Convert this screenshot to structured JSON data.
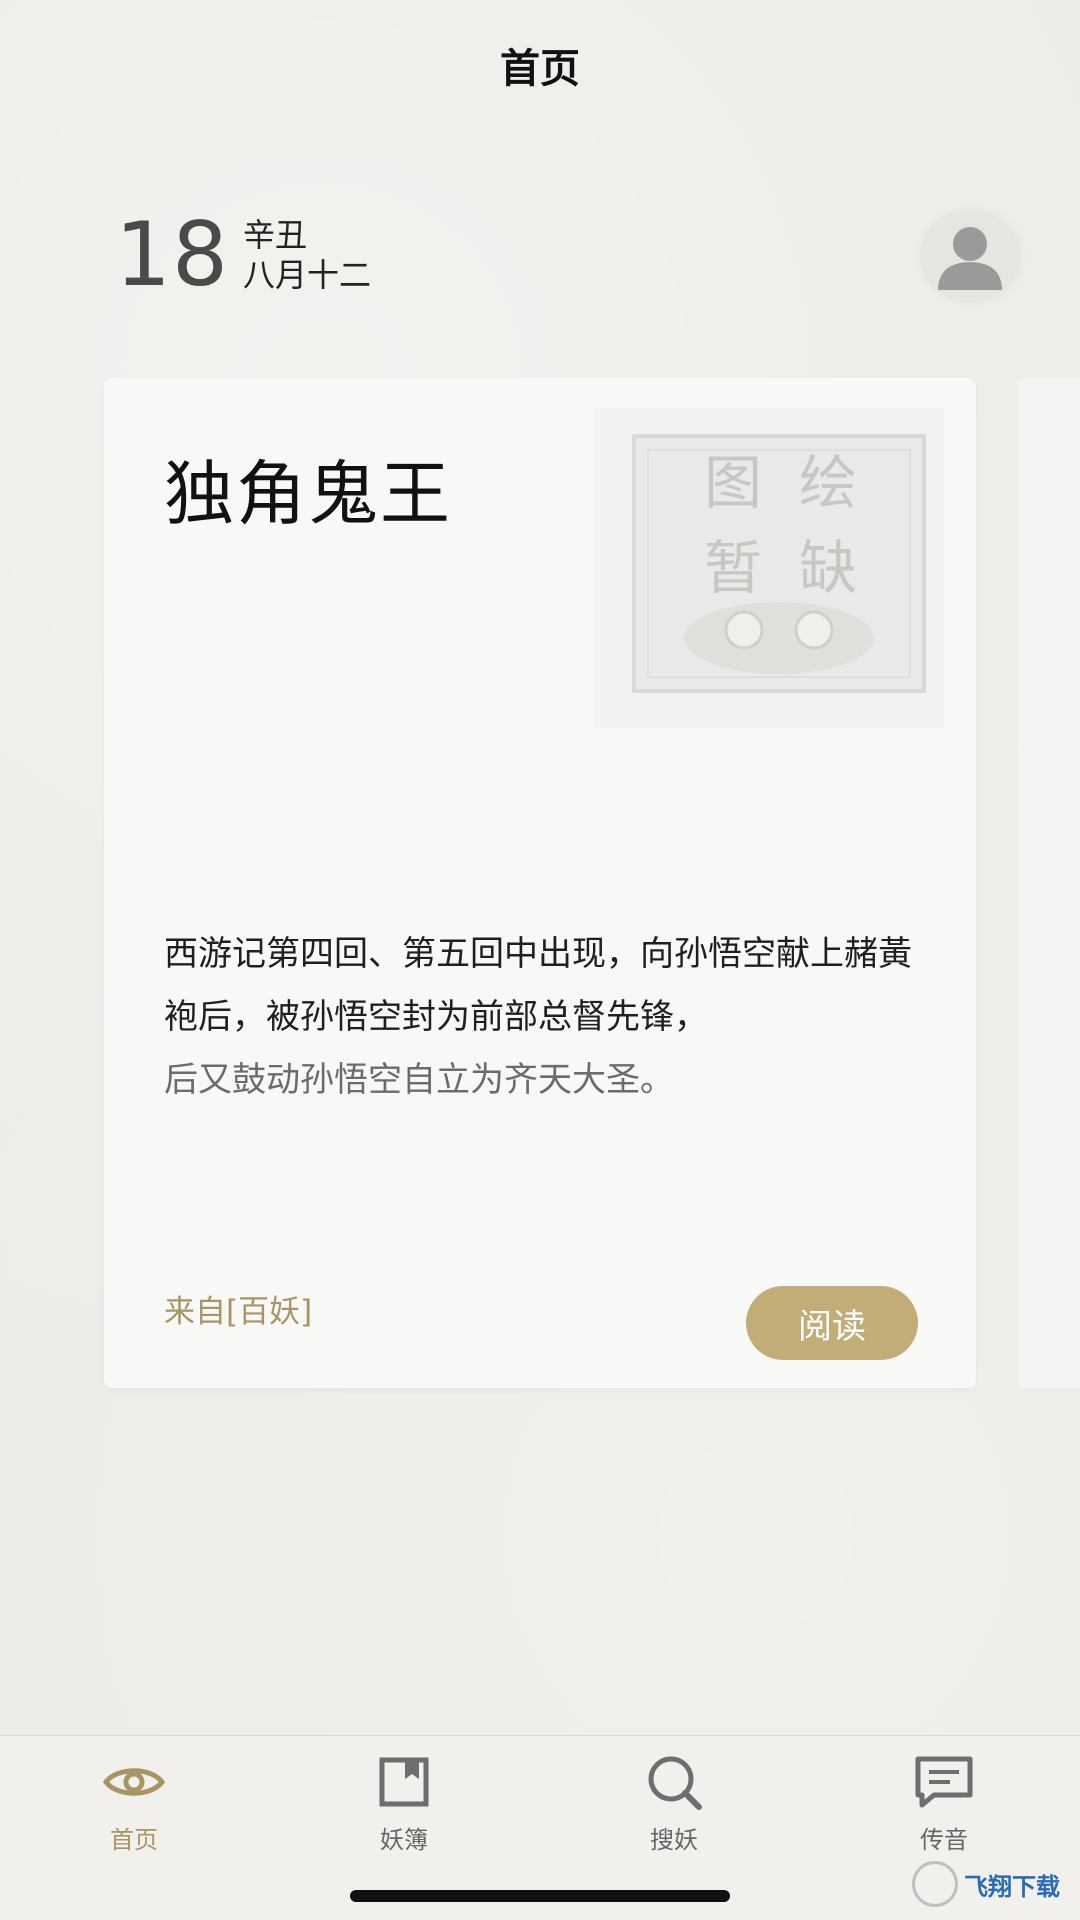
{
  "header": {
    "title": "首页"
  },
  "date": {
    "day": "18",
    "year_ganzhi": "辛丑",
    "lunar_date": "八月十二"
  },
  "card": {
    "title": "独角鬼王",
    "image_text": [
      "图",
      "绘",
      "暂",
      "缺"
    ],
    "description_main": "西游记第四回、第五回中出现，向孙悟空献上赭黃袍后，被孙悟空封为前部总督先锋，",
    "description_fade": "后又鼓动孙悟空自立为齐天大圣。",
    "source": "来自[百妖]",
    "read_label": "阅读"
  },
  "tabs": [
    {
      "label": "首页",
      "icon": "eye-icon",
      "active": true
    },
    {
      "label": "妖簿",
      "icon": "bookmark-icon",
      "active": false
    },
    {
      "label": "搜妖",
      "icon": "search-icon",
      "active": false
    },
    {
      "label": "传音",
      "icon": "message-icon",
      "active": false
    }
  ],
  "colors": {
    "accent": "#c2ad79",
    "accent_text": "#a89566",
    "background": "#ecebe7"
  },
  "watermark": {
    "text": "飞翔下载"
  }
}
